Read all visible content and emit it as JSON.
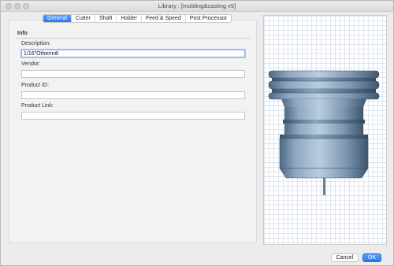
{
  "window": {
    "title": "Library : [molding&casting v5]"
  },
  "tabs": [
    {
      "label": "General",
      "active": true
    },
    {
      "label": "Cutter",
      "active": false
    },
    {
      "label": "Shaft",
      "active": false
    },
    {
      "label": "Holder",
      "active": false
    },
    {
      "label": "Feed & Speed",
      "active": false
    },
    {
      "label": "Post Processor",
      "active": false
    }
  ],
  "info": {
    "section_title": "Info",
    "description_label": "Description:",
    "description_value": "1/16\"Othermill",
    "vendor_label": "Vendor:",
    "vendor_value": "",
    "product_id_label": "Product ID:",
    "product_id_value": "",
    "product_link_label": "Product Link:",
    "product_link_value": ""
  },
  "buttons": {
    "cancel": "Cancel",
    "ok": "OK"
  },
  "colors": {
    "accent": "#2b78ef",
    "tool_body": "#7e9ab4"
  }
}
